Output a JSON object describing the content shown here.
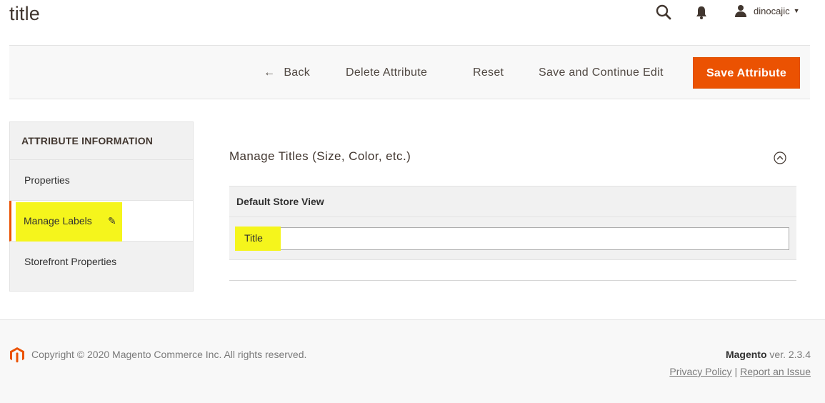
{
  "page": {
    "title": "title"
  },
  "header": {
    "search_icon": "search-icon",
    "notifications_icon": "bell-icon",
    "user": {
      "icon": "user-icon",
      "name": "dinocajic"
    }
  },
  "actions": {
    "back_label": "Back",
    "delete_label": "Delete Attribute",
    "reset_label": "Reset",
    "save_continue_label": "Save and Continue Edit",
    "save_label": "Save Attribute",
    "accent_color": "#eb5202"
  },
  "sidebar": {
    "title": "ATTRIBUTE INFORMATION",
    "items": [
      {
        "label": "Properties",
        "active": false
      },
      {
        "label": "Manage Labels",
        "active": true
      },
      {
        "label": "Storefront Properties",
        "active": false
      }
    ],
    "highlight_color": "#f5f51c"
  },
  "main": {
    "section_title": "Manage Titles (Size, Color, etc.)",
    "store_view_header": "Default Store View",
    "store_view_value": "Title"
  },
  "footer": {
    "copyright": "Copyright © 2020 Magento Commerce Inc. All rights reserved.",
    "brand": "Magento",
    "version": "ver. 2.3.4",
    "privacy_link": "Privacy Policy",
    "separator": "|",
    "report_link": "Report an Issue"
  }
}
